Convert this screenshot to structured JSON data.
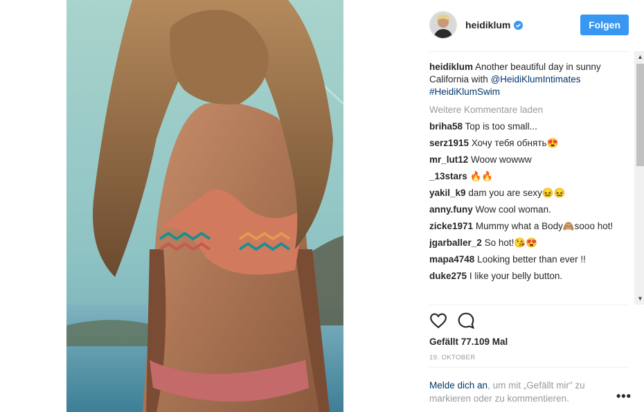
{
  "post": {
    "username": "heidiklum",
    "follow_label": "Folgen",
    "caption_user": "heidiklum",
    "caption_text": "Another beautiful day in sunny California with",
    "caption_mention": "@HeidiKlumIntimates",
    "caption_hashtag": "#HeidiKlumSwim",
    "load_more": "Weitere Kommentare laden",
    "comments": [
      {
        "user": "briha58",
        "text": "Top is too small..."
      },
      {
        "user": "serz1915",
        "text": "Хочу тебя обнять😍"
      },
      {
        "user": "mr_lut12",
        "text": "Woow wowww"
      },
      {
        "user": "_13stars",
        "text": "🔥🔥"
      },
      {
        "user": "yakil_k9",
        "text": "dam you are sexy😖😖"
      },
      {
        "user": "anny.funy",
        "text": "Wow cool woman."
      },
      {
        "user": "zicke1971",
        "text": "Mummy what a Body🙈sooo hot!"
      },
      {
        "user": "jgarballer_2",
        "text": "So hot!😘😍"
      },
      {
        "user": "mapa4748",
        "text": "Looking better than ever !!"
      },
      {
        "user": "duke275",
        "text": "I like your belly button."
      }
    ],
    "likes": "Gefällt 77.109 Mal",
    "date": "19. OKTOBER",
    "login_link": "Melde dich an",
    "login_text": ", um mit „Gefällt mir\" zu markieren oder zu kommentieren.",
    "more_label": "•••"
  },
  "icons": {
    "verified": "verified-badge-icon",
    "like": "heart-icon",
    "comment": "comment-bubble-icon",
    "more": "more-options-icon"
  },
  "colors": {
    "accent": "#3897f0",
    "link": "#003569",
    "muted": "#999999"
  }
}
